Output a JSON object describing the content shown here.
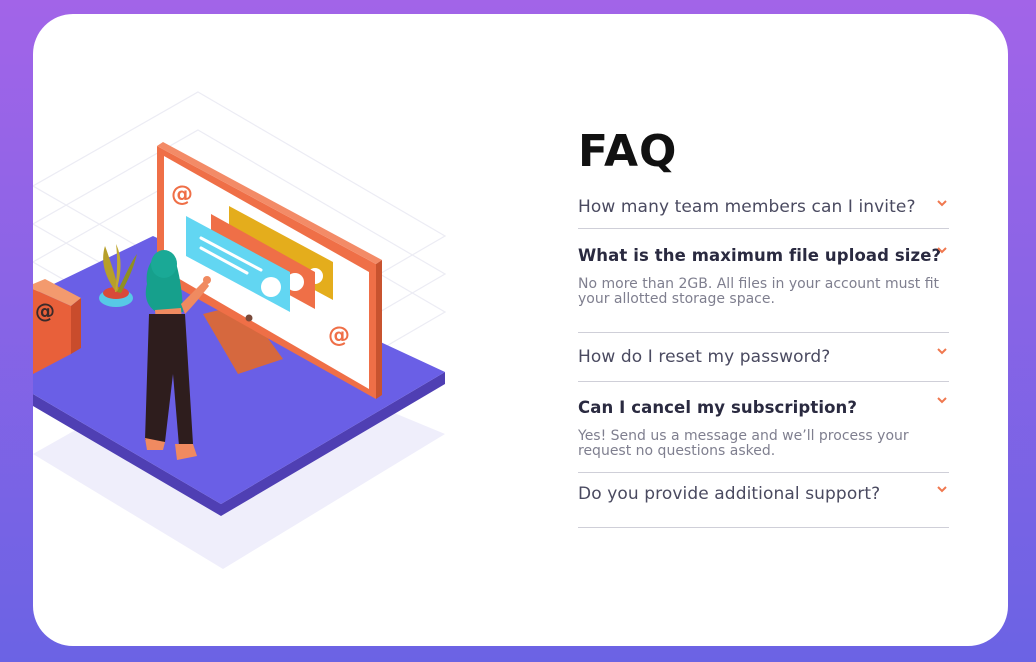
{
  "faq": {
    "title": "FAQ",
    "items": [
      {
        "question": "How many team members can I invite?",
        "answer": "",
        "open": false
      },
      {
        "question": "What is the maximum file upload size?",
        "answer": "No more than 2GB. All files in your account must fit your allotted storage space.",
        "open": true
      },
      {
        "question": "How do I reset my password?",
        "answer": "",
        "open": false
      },
      {
        "question": "Can I cancel my subscription?",
        "answer": "Yes! Send us a message and we’ll process your request no questions asked.",
        "open": true
      },
      {
        "question": "Do you provide additional support?",
        "answer": "",
        "open": false
      }
    ]
  },
  "icons": {
    "chevron": "chevron-down-icon"
  },
  "colors": {
    "background_top": "#a264e8",
    "background_bottom": "#6b63e4",
    "accent": "#f0784f",
    "platform": "#6a5fe6",
    "text_dark": "#2a2a40",
    "text_muted": "#7f7f8f"
  }
}
